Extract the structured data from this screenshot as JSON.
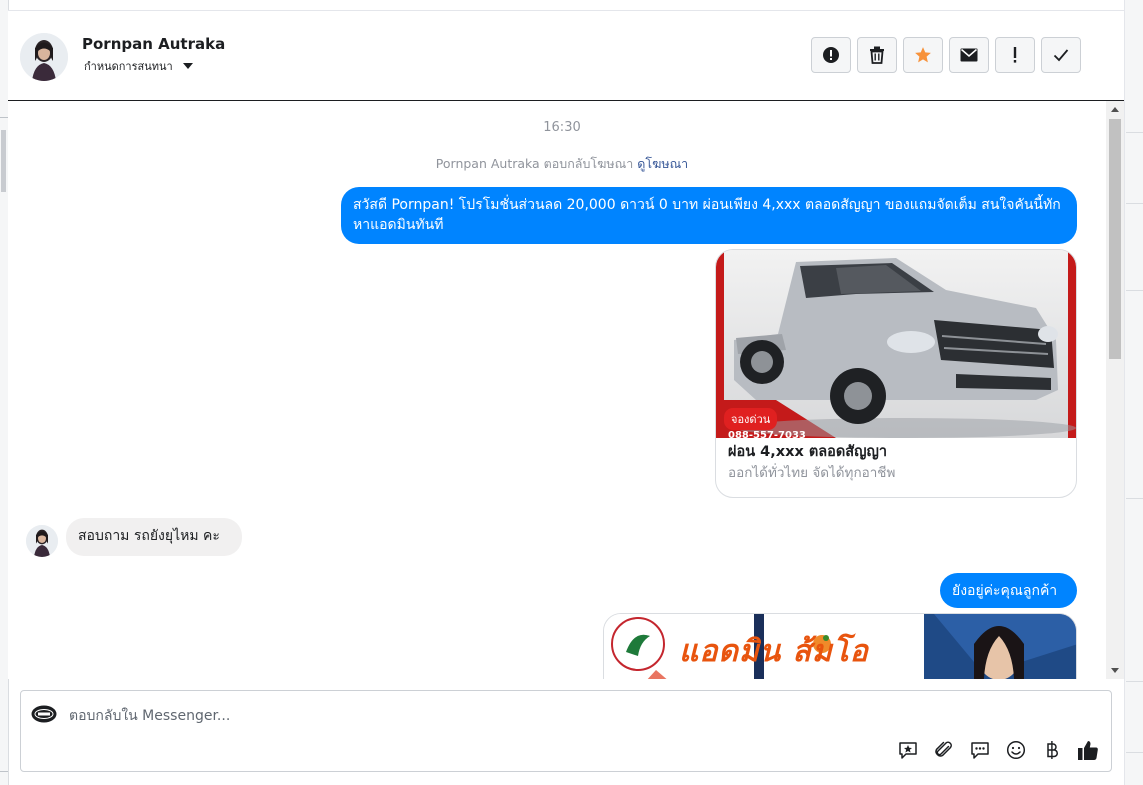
{
  "header": {
    "contact_name": "Pornpan Autraka",
    "assign_label": "กำหนดการสนทนา",
    "actions": [
      {
        "name": "report-icon"
      },
      {
        "name": "trash-icon"
      },
      {
        "name": "star-icon",
        "color": "#f7923b"
      },
      {
        "name": "mail-icon"
      },
      {
        "name": "exclamation-icon"
      },
      {
        "name": "check-icon"
      }
    ]
  },
  "thread": {
    "timestamp": "16:30",
    "system_note": {
      "text": "Pornpan Autraka ตอบกลับโฆษณา",
      "link": "ดูโฆษณา"
    },
    "outgoing_1": "สวัสดี Pornpan! โปรโมชั่นส่วนลด 20,000 ดาวน์ 0 บาท ผ่อนเพียง 4,xxx ตลอดสัญญา ของแถมจัดเต็ม สนใจคันนี้ทักหาแอดมินทันที",
    "ad_card": {
      "badge": "จองด่วน",
      "phone": "088-557-7033",
      "title": "ผ่อน 4,xxx ตลอดสัญญา",
      "subtitle": "ออกได้ทั่วไทย จัดได้ทุกอาชีพ"
    },
    "incoming_1": "สอบถาม รถยังยุไหม คะ",
    "outgoing_2": "ยังอยู่ค่ะคุณลูกค้า",
    "banner_text": "แอดมิน ส้มโอ"
  },
  "composer": {
    "placeholder": "ตอบกลับใน Messenger...",
    "tools": [
      "saved-reply-icon",
      "attachment-icon",
      "quick-reply-icon",
      "emoji-icon",
      "baht-icon",
      "like-icon"
    ]
  },
  "colors": {
    "accent": "#0084ff",
    "star": "#f7923b",
    "incoming_bubble": "#f1f0f0"
  }
}
